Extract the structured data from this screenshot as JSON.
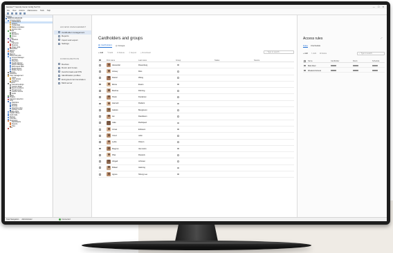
{
  "window": {
    "title": "Genetec™ Security Center Config Tool 5.9",
    "menu": [
      "File",
      "View",
      "Actions",
      "Maintenance",
      "Tools",
      "Help"
    ],
    "controls": [
      "—",
      "☐",
      "✕"
    ]
  },
  "tree": {
    "header": "System",
    "items": [
      {
        "label": "LENOVO-DIG3LVM",
        "color": "#4a7bc0",
        "indent": 0
      },
      {
        "label": "Access control",
        "color": "#5b8dd6",
        "indent": 1
      },
      {
        "label": "Cardholders",
        "color": "#d9a441",
        "indent": 2
      },
      {
        "label": "Visitors",
        "color": "#d9a441",
        "indent": 2
      },
      {
        "label": "Credentials",
        "color": "#d9a441",
        "indent": 2
      },
      {
        "label": "Badge templates",
        "color": "#d9a441",
        "indent": 2
      },
      {
        "label": "Access rules",
        "color": "#d9a441",
        "indent": 2
      },
      {
        "label": "Areas",
        "color": "#5ba35b",
        "indent": 1
      },
      {
        "label": "Doors",
        "color": "#5ba35b",
        "indent": 2
      },
      {
        "label": "Elevators",
        "color": "#5ba35b",
        "indent": 2
      },
      {
        "label": "Zones",
        "color": "#5ba35b",
        "indent": 2
      },
      {
        "label": "Units",
        "color": "#8c6bb5",
        "indent": 1
      },
      {
        "label": "Readers",
        "color": "#8c6bb5",
        "indent": 2
      },
      {
        "label": "Video",
        "color": "#c0504d",
        "indent": 1
      },
      {
        "label": "Cameras",
        "color": "#c0504d",
        "indent": 2
      },
      {
        "label": "Monitors",
        "color": "#c0504d",
        "indent": 2
      },
      {
        "label": "Video Units",
        "color": "#c0504d",
        "indent": 2
      },
      {
        "label": "Schedules",
        "color": "#4a7bc0",
        "indent": 1
      },
      {
        "label": "Alarms",
        "color": "#e07b39",
        "indent": 1
      },
      {
        "label": "Tasks",
        "color": "#4a7bc0",
        "indent": 1
      },
      {
        "label": "Macros",
        "color": "#4a7bc0",
        "indent": 1
      },
      {
        "label": "Roles and units",
        "color": "#5b8dd6",
        "indent": 1
      },
      {
        "label": "Access Manager",
        "color": "#5b8dd6",
        "indent": 2
      },
      {
        "label": "Archiver",
        "color": "#5b8dd6",
        "indent": 2
      },
      {
        "label": "Directory",
        "color": "#5b8dd6",
        "indent": 2
      },
      {
        "label": "Health Monitor",
        "color": "#5b8dd6",
        "indent": 2
      },
      {
        "label": "Report Manager",
        "color": "#5b8dd6",
        "indent": 2
      },
      {
        "label": "Web-based SDK",
        "color": "#5b8dd6",
        "indent": 2
      },
      {
        "label": "Media Router",
        "color": "#5b8dd6",
        "indent": 2
      },
      {
        "label": "Mobile Server",
        "color": "#5b8dd6",
        "indent": 2
      },
      {
        "label": "Servers",
        "color": "#7a7a7a",
        "indent": 1
      },
      {
        "label": "Networks",
        "color": "#7a7a7a",
        "indent": 1
      },
      {
        "label": "User management",
        "color": "#d9a441",
        "indent": 1
      },
      {
        "label": "Users",
        "color": "#d9a441",
        "indent": 2
      },
      {
        "label": "User groups",
        "color": "#d9a441",
        "indent": 2
      },
      {
        "label": "Partitions",
        "color": "#d9a441",
        "indent": 2
      },
      {
        "label": "System",
        "color": "#7a7a7a",
        "indent": 1
      },
      {
        "label": "General settings",
        "color": "#7a7a7a",
        "indent": 2
      },
      {
        "label": "Custom fields",
        "color": "#7a7a7a",
        "indent": 2
      },
      {
        "label": "Event to actions",
        "color": "#7a7a7a",
        "indent": 2
      },
      {
        "label": "Threat levels",
        "color": "#7a7a7a",
        "indent": 2
      },
      {
        "label": "Custom events",
        "color": "#7a7a7a",
        "indent": 2
      },
      {
        "label": "Audio",
        "color": "#7a7a7a",
        "indent": 2
      },
      {
        "label": "Maps",
        "color": "#5ba35b",
        "indent": 1
      },
      {
        "label": "Plugins",
        "color": "#8c6bb5",
        "indent": 1
      },
      {
        "label": "Intrusion detection",
        "color": "#c0504d",
        "indent": 1
      },
      {
        "label": "LPR",
        "color": "#4a7bc0",
        "indent": 1
      },
      {
        "label": "Patrollers",
        "color": "#4a7bc0",
        "indent": 2
      },
      {
        "label": "Hotlists",
        "color": "#4a7bc0",
        "indent": 2
      },
      {
        "label": "Permits",
        "color": "#4a7bc0",
        "indent": 2
      },
      {
        "label": "Overtime rules",
        "color": "#4a7bc0",
        "indent": 2
      },
      {
        "label": "Parking zones",
        "color": "#4a7bc0",
        "indent": 2
      },
      {
        "label": "Mobile Apps",
        "color": "#5b8dd6",
        "indent": 1
      },
      {
        "label": "Health history",
        "color": "#5b8dd6",
        "indent": 1
      },
      {
        "label": "Audit trails",
        "color": "#5b8dd6",
        "indent": 1
      },
      {
        "label": "Backup",
        "color": "#5b8dd6",
        "indent": 1
      },
      {
        "label": "Licenses",
        "color": "#5b8dd6",
        "indent": 1
      },
      {
        "label": "Monitoring",
        "color": "#e07b39",
        "indent": 1
      },
      {
        "label": "Dashboards",
        "color": "#e07b39",
        "indent": 2
      },
      {
        "label": "Reports",
        "color": "#e07b39",
        "indent": 2
      },
      {
        "label": "Tiles",
        "color": "#e07b39",
        "indent": 2
      },
      {
        "label": "Site",
        "color": "#c0504d",
        "indent": 1
      }
    ],
    "selected_index": 2
  },
  "statusbar": {
    "left": [
      "Task Navigation",
      "Administrator",
      "Admin"
    ],
    "connection": "Connected"
  },
  "subnav": {
    "section1": "ACCESS MANAGEMENT",
    "items1": [
      "Cardholder management",
      "Reports",
      "Import and export",
      "Settings"
    ],
    "section2": "CONFIGURATION",
    "items2": [
      "Devices",
      "Doors and zones",
      "Card formats and PIN",
      "Identification profiles",
      "Encrypted communication",
      "Multi server"
    ],
    "collapse": "«"
  },
  "main": {
    "title": "Cardholders and groups",
    "tabs": [
      "Cardholders",
      "Groups"
    ],
    "actions": [
      "+ Add",
      "✎ Edit",
      "⧉ Delete",
      "⇩ Export",
      "⤓ Download"
    ],
    "search_placeholder": "Type to search...",
    "columns": {
      "first": "First name",
      "last": "Last name",
      "group": "Group",
      "status": "Status",
      "source": "Source"
    },
    "rows": [
      {
        "first": "Alexander",
        "last": "Rosenberg"
      },
      {
        "first": "Antoey",
        "last": "Rios"
      },
      {
        "first": "Daniel",
        "last": "Wang"
      },
      {
        "first": "Elena",
        "last": "Evans"
      },
      {
        "first": "Martina",
        "last": "Rohring"
      },
      {
        "first": "Pietro",
        "last": "Dunlarosi"
      },
      {
        "first": "Hannah",
        "last": "Rodeini"
      },
      {
        "first": "Isabelo",
        "last": "Bengtsson"
      },
      {
        "first": "Ian",
        "last": "Davidsson"
      },
      {
        "first": "Jake",
        "last": "Rodriquez"
      },
      {
        "first": "Jonas",
        "last": "Eriksson"
      },
      {
        "first": "Yozef",
        "last": "Jahn"
      },
      {
        "first": "Lydia",
        "last": "Olsson"
      },
      {
        "first": "Magnus",
        "last": "Van Holm"
      },
      {
        "first": "Pilar",
        "last": "Rostock"
      },
      {
        "first": "Abigail",
        "last": "Johnsen"
      },
      {
        "first": "Mikael",
        "last": "Aaskrog"
      },
      {
        "first": "Agnes",
        "last": "Sheng Lee"
      }
    ],
    "avatar_colors": [
      "#b98a6a",
      "#d3b08f",
      "#a6775c",
      "#e0c1a1",
      "#c9a98e",
      "#b58b6c",
      "#d8b797",
      "#a3805f",
      "#c49c7c",
      "#7c5a44",
      "#d7b394",
      "#b9906f",
      "#caa385",
      "#ac8262",
      "#dbbd9f",
      "#8f6a51",
      "#c4a184",
      "#b88d6b"
    ]
  },
  "rules": {
    "title": "Access rules",
    "close": "⤢",
    "tabs": [
      "Rules",
      "Unschedule"
    ],
    "actions": [
      "+ Add",
      "✎ Edit",
      "⧉ Delete"
    ],
    "search_placeholder": "Type to search...",
    "columns": {
      "name": "Name",
      "cardholder": "Cardholder",
      "doors": "Doors",
      "schedule": "Schedule"
    },
    "rows": [
      {
        "name": "Main Door"
      },
      {
        "name": "Weekend Access"
      }
    ]
  },
  "colors": {
    "accent": "#1f6ed4",
    "selected": "#cde1f8",
    "connected": "#3ea03e"
  }
}
